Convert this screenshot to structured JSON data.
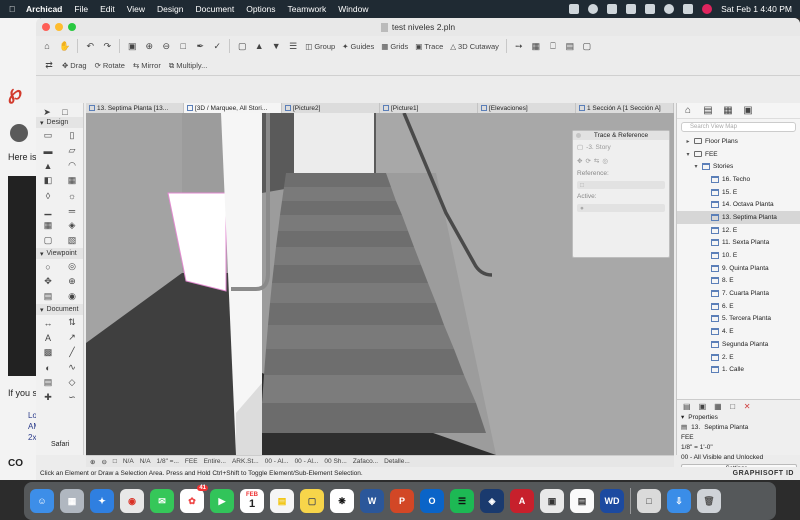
{
  "menubar": {
    "app_name": "Archicad",
    "items": [
      "File",
      "Edit",
      "View",
      "Design",
      "Document",
      "Options",
      "Teamwork",
      "Window"
    ],
    "datetime": "Sat Feb 1  4:40 PM"
  },
  "background_page": {
    "here_text": "Here is",
    "if_you_text": "If you st",
    "lines": [
      "Lo",
      "AM",
      "2x"
    ],
    "badge": "CO"
  },
  "window": {
    "title": "test niveles 2.pln"
  },
  "toolbar": {
    "group_label": "Group",
    "guides_label": "Guides",
    "grids_label": "Grids",
    "trace_label": "Trace",
    "cutaway_label": "3D Cutaway",
    "drag_label": "Drag",
    "rotate_label": "Rotate",
    "mirror_label": "Mirror",
    "multiply_label": "Multiply..."
  },
  "toolbox": {
    "design_header": "Design",
    "viewpoint_header": "Viewpoint",
    "document_header": "Document"
  },
  "tabs": [
    {
      "label": "13. Septima Planta [13...",
      "active": false
    },
    {
      "label": "[3D / Marquee, All Stori...",
      "active": true
    },
    {
      "label": "[Picture2]",
      "active": false
    },
    {
      "label": "[Picture1]",
      "active": false
    },
    {
      "label": "[Elevaciones]",
      "active": false
    },
    {
      "label": "1 Sección A [1 Sección A]",
      "active": false
    }
  ],
  "trace_palette": {
    "title": "Trace & Reference",
    "story_placeholder": "-3. Story",
    "reference_label": "Reference:",
    "active_label": "Active:"
  },
  "navigator": {
    "search_placeholder": "Search View Map",
    "floor_plans": "Floor Plans",
    "fee": "FEE",
    "stories": "Stories",
    "story_items": [
      "16. Techo",
      "15. E",
      "14. Octava Planta",
      "13. Septima Planta",
      "12. E",
      "11. Sexta Planta",
      "10. E",
      "9. Quinta Planta",
      "8. E",
      "7. Cuarta Planta",
      "6. E",
      "5. Tercera Planta",
      "4. E",
      "Segunda Planta",
      "2. E",
      "1. Calle"
    ],
    "selected_index": 3,
    "properties_label": "Properties",
    "prop_id": "13.",
    "prop_name": "Septima Planta",
    "prop_fee": "FEE",
    "prop_scale": "1/8\"  =  1'-0\"",
    "prop_layers": "00 - All Visible and Unlocked",
    "settings_label": "Settings..."
  },
  "statusbar": {
    "items": [
      "N/A",
      "N/A",
      "1/8\" =...",
      "FEE",
      "Entire...",
      "ARK.St...",
      "00 - Al...",
      "00 - Al...",
      "00 Sh...",
      "Zafaco...",
      "Detalle..."
    ]
  },
  "hintbar": {
    "hint": "Click an Element or Draw a Selection Area. Press and Hold Ctrl+Shift to Toggle Element/Sub-Element Selection.",
    "brand": "GRAPHISOFT ID"
  },
  "safari_label": "Safari",
  "dock": {
    "calendar_month": "FEB",
    "calendar_day": "1",
    "photos_badge": "41",
    "apps": [
      "Finder",
      "Launchpad",
      "Safari",
      "Chrome",
      "Messages",
      "Photos",
      "FaceTime",
      "Calendar",
      "Notes",
      "Stickies",
      "ChatGPT",
      "Word",
      "PowerPoint",
      "Outlook",
      "Spotify",
      "SketchUp",
      "Archicad",
      "Preview",
      "Notes2",
      "WD",
      "Finder2",
      "Downloads",
      "Trash"
    ]
  }
}
